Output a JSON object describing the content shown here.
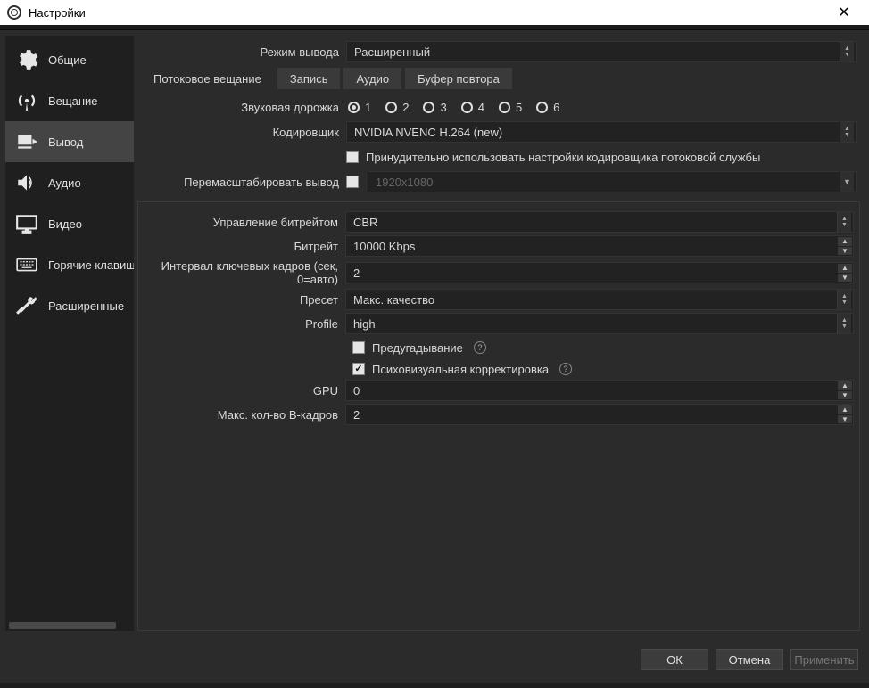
{
  "window": {
    "title": "Настройки"
  },
  "sidebar": {
    "items": [
      {
        "label": "Общие"
      },
      {
        "label": "Вещание"
      },
      {
        "label": "Вывод"
      },
      {
        "label": "Аудио"
      },
      {
        "label": "Видео"
      },
      {
        "label": "Горячие клавиши"
      },
      {
        "label": "Расширенные"
      }
    ]
  },
  "output": {
    "mode_label": "Режим вывода",
    "mode_value": "Расширенный",
    "tabs": [
      {
        "label": "Потоковое вещание"
      },
      {
        "label": "Запись"
      },
      {
        "label": "Аудио"
      },
      {
        "label": "Буфер повтора"
      }
    ],
    "audio_track_label": "Звуковая дорожка",
    "audio_tracks": [
      "1",
      "2",
      "3",
      "4",
      "5",
      "6"
    ],
    "audio_track_selected": "1",
    "encoder_label": "Кодировщик",
    "encoder_value": "NVIDIA NVENC H.264 (new)",
    "enforce_label": "Принудительно использовать настройки кодировщика потоковой службы",
    "rescale_label": "Перемасштабировать вывод",
    "rescale_placeholder": "1920x1080"
  },
  "encoder": {
    "rate_control_label": "Управление битрейтом",
    "rate_control_value": "CBR",
    "bitrate_label": "Битрейт",
    "bitrate_value": "10000 Kbps",
    "keyint_label": "Интервал ключевых кадров (сек, 0=авто)",
    "keyint_value": "2",
    "preset_label": "Пресет",
    "preset_value": "Макс. качество",
    "profile_label": "Profile",
    "profile_value": "high",
    "lookahead_label": "Предугадывание",
    "psycho_label": "Психовизуальная корректировка",
    "gpu_label": "GPU",
    "gpu_value": "0",
    "bframes_label": "Макс. кол-во B-кадров",
    "bframes_value": "2"
  },
  "buttons": {
    "ok": "ОК",
    "cancel": "Отмена",
    "apply": "Применить"
  }
}
